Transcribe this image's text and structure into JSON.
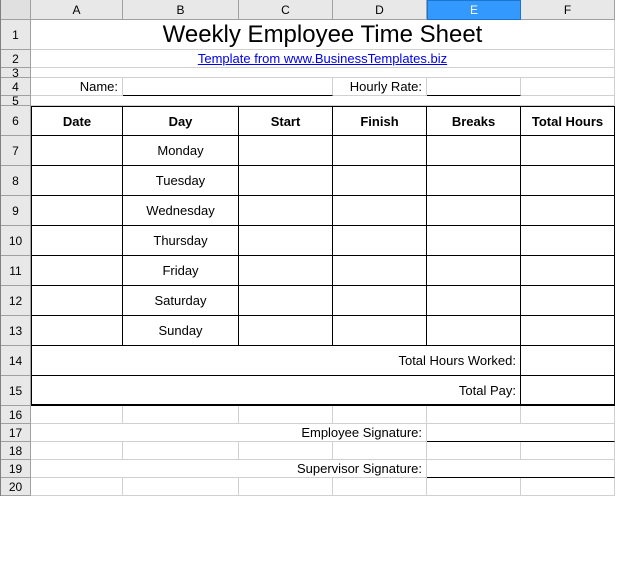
{
  "columns": [
    "A",
    "B",
    "C",
    "D",
    "E",
    "F"
  ],
  "rows": [
    "1",
    "2",
    "3",
    "4",
    "5",
    "6",
    "7",
    "8",
    "9",
    "10",
    "11",
    "12",
    "13",
    "14",
    "15",
    "16",
    "17",
    "18",
    "19",
    "20"
  ],
  "active_col": 5,
  "title": "Weekly Employee Time Sheet",
  "link": "Template from www.BusinessTemplates.biz",
  "labels": {
    "name": "Name:",
    "hourlyRate": "Hourly Rate:",
    "totalHoursWorked": "Total Hours Worked:",
    "totalPay": "Total Pay:",
    "empSig": "Employee Signature:",
    "supSig": "Supervisor Signature:"
  },
  "fields": {
    "name": "",
    "hourlyRate": "",
    "totalHoursWorked": "",
    "totalPay": "",
    "empSig": "",
    "supSig": ""
  },
  "headers": {
    "date": "Date",
    "day": "Day",
    "start": "Start",
    "finish": "Finish",
    "breaks": "Breaks",
    "totalHours": "Total Hours"
  },
  "days": [
    {
      "date": "",
      "day": "Monday",
      "start": "",
      "finish": "",
      "breaks": "",
      "total": ""
    },
    {
      "date": "",
      "day": "Tuesday",
      "start": "",
      "finish": "",
      "breaks": "",
      "total": ""
    },
    {
      "date": "",
      "day": "Wednesday",
      "start": "",
      "finish": "",
      "breaks": "",
      "total": ""
    },
    {
      "date": "",
      "day": "Thursday",
      "start": "",
      "finish": "",
      "breaks": "",
      "total": ""
    },
    {
      "date": "",
      "day": "Friday",
      "start": "",
      "finish": "",
      "breaks": "",
      "total": ""
    },
    {
      "date": "",
      "day": "Saturday",
      "start": "",
      "finish": "",
      "breaks": "",
      "total": ""
    },
    {
      "date": "",
      "day": "Sunday",
      "start": "",
      "finish": "",
      "breaks": "",
      "total": ""
    }
  ]
}
